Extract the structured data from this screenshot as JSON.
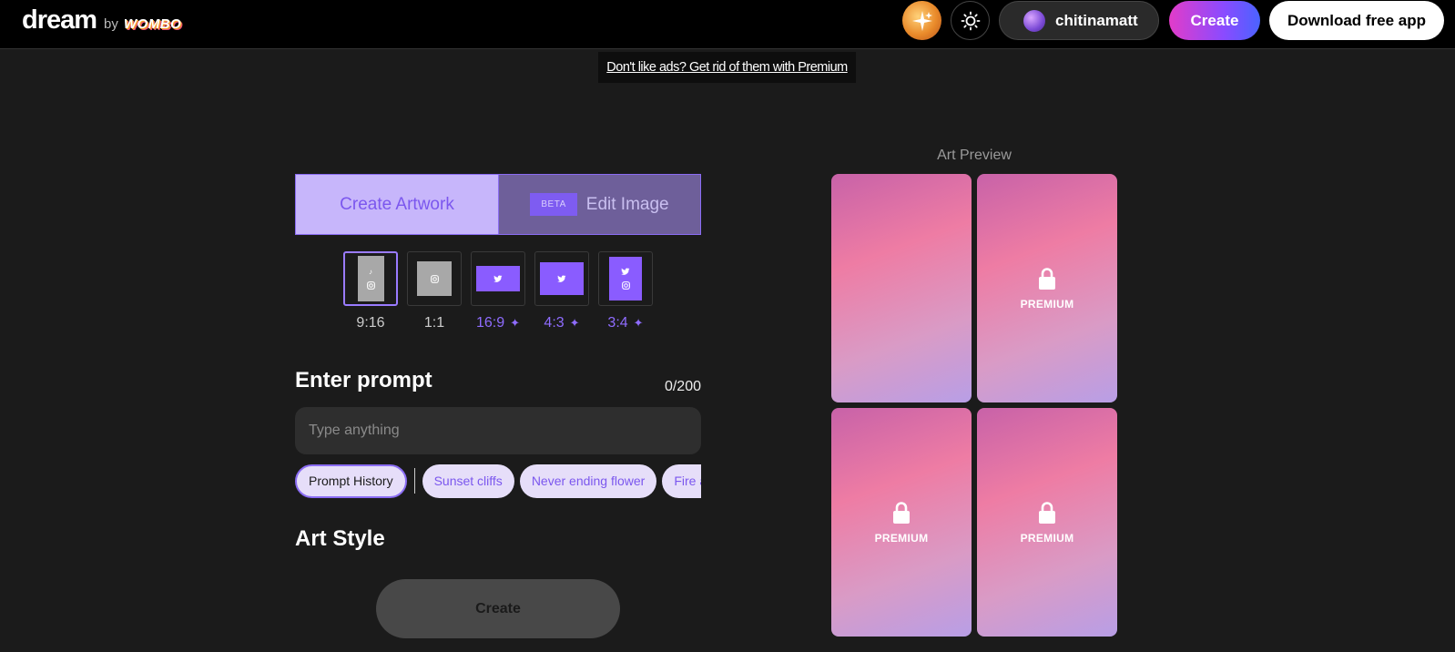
{
  "header": {
    "logo_main": "dream",
    "logo_by": "by",
    "logo_brand": "WOMBO",
    "user_name": "chitinamatt",
    "create_label": "Create",
    "download_label": "Download free app"
  },
  "ad_banner": "Don't like ads? Get rid of them with Premium",
  "mode_tabs": {
    "create_label": "Create Artwork",
    "beta_badge": "BETA",
    "edit_label": "Edit Image"
  },
  "aspect_ratios": [
    {
      "label": "9:16",
      "premium": false,
      "selected": true
    },
    {
      "label": "1:1",
      "premium": false,
      "selected": false
    },
    {
      "label": "16:9",
      "premium": true,
      "selected": false
    },
    {
      "label": "4:3",
      "premium": true,
      "selected": false
    },
    {
      "label": "3:4",
      "premium": true,
      "selected": false
    }
  ],
  "prompt": {
    "title": "Enter prompt",
    "count": "0/200",
    "placeholder": "Type anything"
  },
  "chips": {
    "history_label": "Prompt History",
    "suggestions": [
      "Sunset cliffs",
      "Never ending flower",
      "Fire and water"
    ]
  },
  "art_style_title": "Art Style",
  "create_button_label": "Create",
  "preview": {
    "title": "Art Preview",
    "premium_label": "PREMIUM"
  },
  "colors": {
    "accent": "#8a5cff",
    "tab_selected_bg": "#c7b6fb",
    "page_bg": "#1b1b1b"
  },
  "icons": [
    "sun-icon",
    "lock-icon",
    "tiktok-icon",
    "instagram-icon",
    "twitter-icon",
    "sparkle-icon"
  ]
}
